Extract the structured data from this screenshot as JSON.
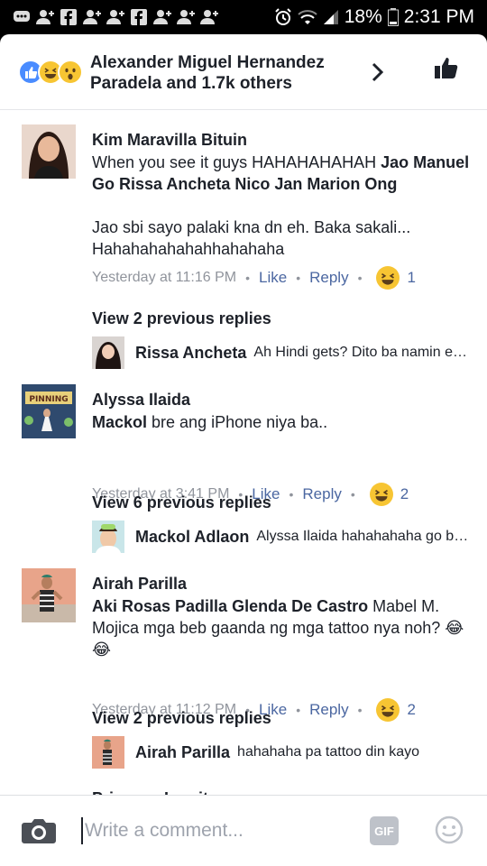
{
  "status_bar": {
    "battery_percent": "18%",
    "time": "2:31 PM",
    "left_icons": [
      "message-icon",
      "person-add-icon",
      "facebook-icon",
      "person-add-icon",
      "person-add-icon",
      "facebook-icon",
      "person-add-icon",
      "person-add-icon",
      "person-add-icon"
    ],
    "right_icons": [
      "alarm-icon",
      "wifi-icon",
      "signal-icon",
      "battery-icon"
    ]
  },
  "header": {
    "reactions": [
      "like",
      "haha",
      "wow"
    ],
    "title": "Alexander Miguel Hernandez Paradela and 1.7k others"
  },
  "comments": [
    {
      "author": "Kim Maravilla Bituin",
      "text_plain_1": "When you see it guys HAHAHAHAHAH ",
      "text_tags_1": "Jao Manuel Go Rissa Ancheta Nico Jan Marion Ong",
      "text_plain_2": "Jao sbi sayo palaki kna dn eh. Baka sakali... Hahahahahahahhahahaha",
      "time": "Yesterday at 11:16 PM",
      "like_label": "Like",
      "reply_label": "Reply",
      "reaction_count": "1",
      "previous_replies": "View 2 previous replies",
      "reply": {
        "name": "Rissa Ancheta",
        "text": "Ah Hindi gets? Dito ba namin ex…"
      }
    },
    {
      "author": "Alyssa Ilaida",
      "text_tag": "Mackol",
      "text_plain": " bre ang iPhone niya ba..",
      "avatar_banner": "PINNING",
      "time": "Yesterday at 3:41 PM",
      "like_label": "Like",
      "reply_label": "Reply",
      "reaction_count": "2",
      "previous_replies": "View 6 previous replies",
      "reply": {
        "name": "Mackol Adlaon",
        "text": "Alyssa Ilaida hahahahaha go b…"
      }
    },
    {
      "author": "Airah Parilla",
      "text_tags": "Aki Rosas Padilla Glenda De Castro",
      "text_plain": " Mabel M. Mojica mga beb gaanda ng mga tattoo nya noh? 😂😂",
      "time": "Yesterday at 11:12 PM",
      "like_label": "Like",
      "reply_label": "Reply",
      "reaction_count": "2",
      "previous_replies": "View 2 previous replies",
      "reply": {
        "name": "Airah Parilla",
        "text": "hahahaha pa tattoo din kayo"
      }
    }
  ],
  "next_comment_partial": "Princess Ingnite",
  "composer": {
    "placeholder": "Write a comment...",
    "gif_label": "GIF"
  },
  "colors": {
    "link_blue": "#4b67a1",
    "meta_gray": "#90949c",
    "like_blue": "#4a8cff",
    "haha_yellow": "#f7c533"
  }
}
